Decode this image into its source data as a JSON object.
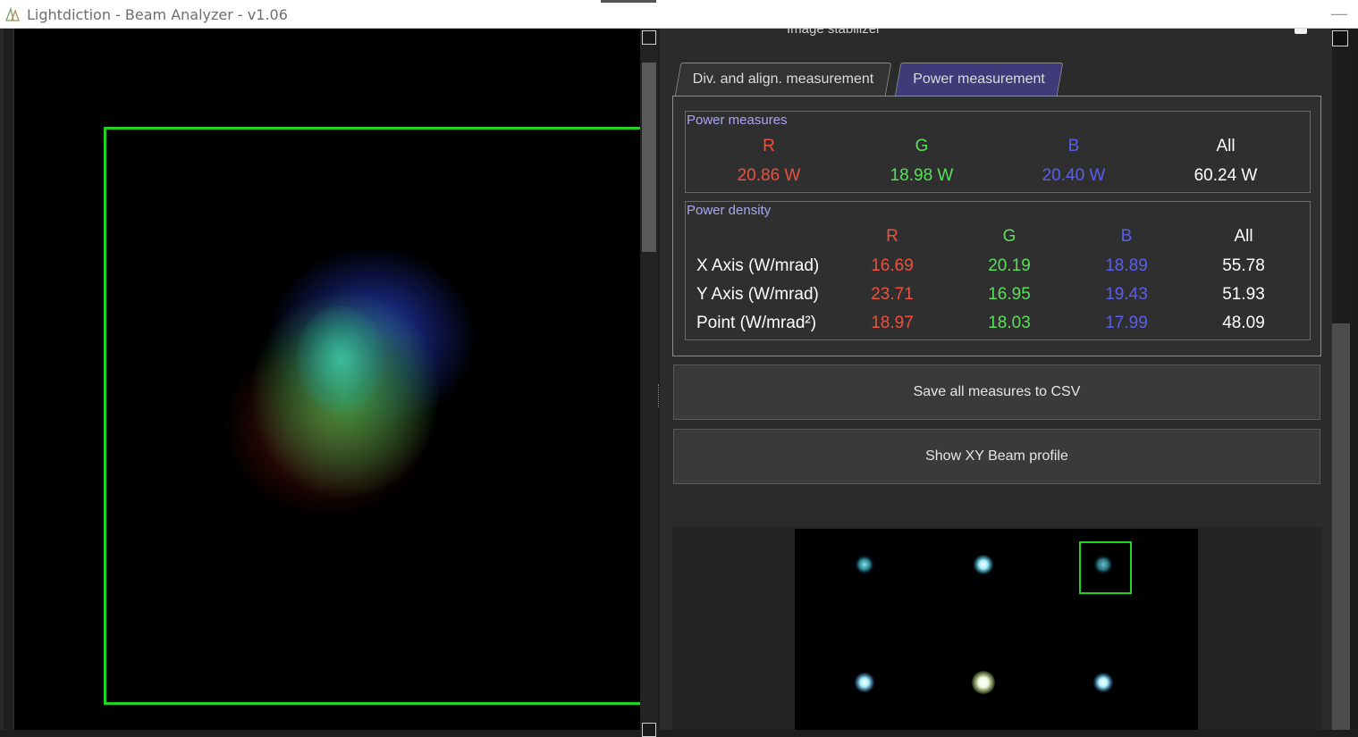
{
  "window": {
    "title": "Lightdiction - Beam Analyzer - v1.06",
    "minimize_glyph": "—"
  },
  "panel": {
    "stabilizer_label": "Image stabilizer",
    "tabs": [
      {
        "label": "Div. and align. measurement",
        "active": false
      },
      {
        "label": "Power measurement",
        "active": true
      }
    ],
    "power_measures": {
      "title": "Power measures",
      "headers": [
        "R",
        "G",
        "B",
        "All"
      ],
      "values": [
        "20.86 W",
        "18.98 W",
        "20.40 W",
        "60.24 W"
      ]
    },
    "power_density": {
      "title": "Power density",
      "headers": [
        "R",
        "G",
        "B",
        "All"
      ],
      "rows": [
        {
          "label": "X Axis (W/mrad)",
          "values": [
            "16.69",
            "20.19",
            "18.89",
            "55.78"
          ]
        },
        {
          "label": "Y Axis (W/mrad)",
          "values": [
            "23.71",
            "16.95",
            "19.43",
            "51.93"
          ]
        },
        {
          "label": "Point (W/mrad²)",
          "values": [
            "18.97",
            "18.03",
            "17.99",
            "48.09"
          ]
        }
      ]
    },
    "buttons": {
      "save_csv": "Save all measures to CSV",
      "show_xy": "Show XY Beam profile"
    }
  },
  "colors": {
    "red": "#f0503c",
    "green": "#58e05a",
    "blue": "#5a5ef0",
    "roi": "#22d422",
    "active_tab": "#3f3a78"
  },
  "icons": [
    "app-logo-icon",
    "minimize-icon"
  ]
}
